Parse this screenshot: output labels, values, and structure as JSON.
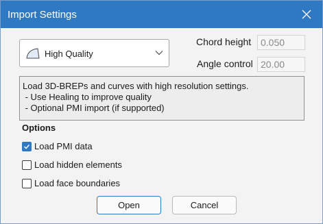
{
  "window": {
    "title": "Import Settings"
  },
  "quality": {
    "selected": "High Quality"
  },
  "fields": {
    "chord_height": {
      "label": "Chord height",
      "value": "0.050"
    },
    "angle_control": {
      "label": "Angle control",
      "value": "20.00"
    }
  },
  "description": {
    "lines": [
      "Load 3D-BREPs and curves with high resolution settings.",
      " - Use Healing to improve quality",
      " - Optional PMI import (if supported)"
    ]
  },
  "options": {
    "heading": "Options",
    "items": [
      {
        "label": "Load PMI data",
        "checked": true
      },
      {
        "label": "Load hidden elements",
        "checked": false
      },
      {
        "label": "Load face boundaries",
        "checked": false
      }
    ]
  },
  "buttons": {
    "open": "Open",
    "cancel": "Cancel"
  },
  "colors": {
    "accent": "#2f79c3"
  },
  "icons": {
    "close": "close-icon",
    "quality": "quality-curve-icon",
    "dropdown": "chevron-down-icon",
    "check": "checkmark-icon"
  }
}
